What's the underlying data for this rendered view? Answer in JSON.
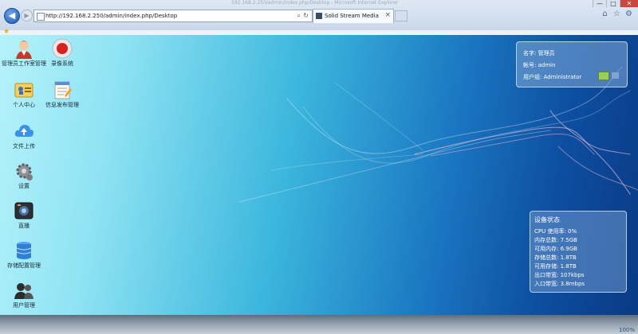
{
  "browser": {
    "url": "http://192.168.2.250/admin/index.php/Desktop",
    "tab_title": "Solid Stream Media Syst...",
    "window_title": "192.168.2.250/admin/index.php/Desktop - Microsoft Internet Explorer",
    "window_controls": [
      "—",
      "□",
      "✕"
    ],
    "icons": [
      "back-icon",
      "forward-icon",
      "search-icon",
      "refresh-icon",
      "close-tab-icon",
      "home-icon",
      "favorites-icon",
      "settings-icon"
    ]
  },
  "desktop_icons": [
    {
      "key": "user-manage",
      "label": "管理员工作室管理",
      "icon": "user-icon"
    },
    {
      "key": "record",
      "label": "录像系统",
      "icon": "record-icon"
    },
    {
      "key": "personal",
      "label": "个人中心",
      "icon": "id-card-icon"
    },
    {
      "key": "notes",
      "label": "信息发布管理",
      "icon": "notepad-icon"
    },
    {
      "key": "upload",
      "label": "文件上传",
      "icon": "cloud-upload-icon"
    },
    {
      "key": "settings",
      "label": "设置",
      "icon": "gear-icon"
    },
    {
      "key": "live",
      "label": "直播",
      "icon": "camera-icon"
    },
    {
      "key": "storage",
      "label": "存储配置管理",
      "icon": "database-icon"
    },
    {
      "key": "users",
      "label": "用户管理",
      "icon": "users-icon"
    }
  ],
  "user_panel": {
    "name": "名字: 管理员",
    "account": "帐号: admin",
    "group": "用户组: Administrator"
  },
  "status": {
    "title": "设备状态",
    "cpu": "CPU 使用率: 0%",
    "mem_total": "内存总数: 7.5GB",
    "mem_free": "可用内存: 6.9GB",
    "storage_total": "存储总数: 1.8TB",
    "storage_free": "可用存储: 1.8TB",
    "bw_out": "出口带宽: 107kbps",
    "bw_in": "入口带宽: 3.8mbps"
  },
  "taskbar": {
    "tray_text": "100%"
  }
}
